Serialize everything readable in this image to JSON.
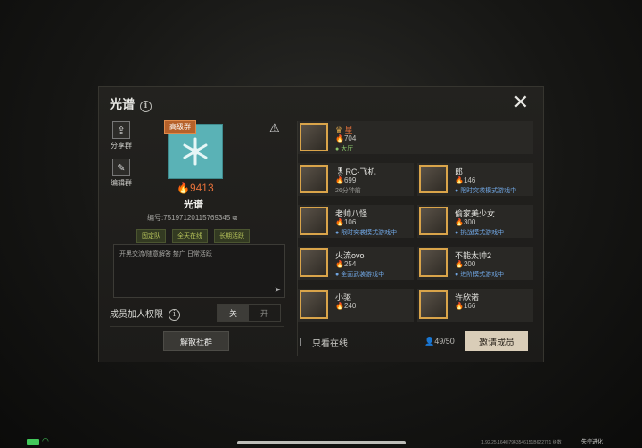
{
  "header": {
    "title": "光谱",
    "info_icon": "info-icon",
    "close_icon": "close-icon"
  },
  "left": {
    "share_label": "分享群",
    "edit_label": "编辑群",
    "tag": "高级群",
    "heat": "9413",
    "group_name": "光谱",
    "group_id": "编号:75197120115769345",
    "traits": [
      "固定队",
      "全天在线",
      "长期活跃"
    ],
    "notice": "开黑交流/随意解答 禁广 日常活跃",
    "permission_label": "成员加人权限",
    "toggle_off": "关",
    "toggle_on": "开",
    "disband_label": "解散社群"
  },
  "members": [
    {
      "name": "星",
      "score": "704",
      "status": "大厅",
      "kind": "lobby"
    },
    {
      "name": "RC-飞机",
      "score": "699",
      "status": "26分钟前",
      "kind": "idle"
    },
    {
      "name": "郎",
      "score": "146",
      "status": "限时突袭模式游戏中",
      "kind": "game"
    },
    {
      "name": "老帅八怪",
      "score": "106",
      "status": "限时突袭模式游戏中",
      "kind": "game"
    },
    {
      "name": "偷家美少女",
      "score": "300",
      "status": "挑战模式游戏中",
      "kind": "game"
    },
    {
      "name": "火流ovo",
      "score": "254",
      "status": "全面武装游戏中",
      "kind": "game"
    },
    {
      "name": "不能太帅2",
      "score": "200",
      "status": "进阶模式游戏中",
      "kind": "game"
    },
    {
      "name": "小驱",
      "score": "240",
      "status": "",
      "kind": "idle"
    },
    {
      "name": "许欣诺",
      "score": "166",
      "status": "",
      "kind": "idle"
    }
  ],
  "footer": {
    "online_only": "只看在线",
    "count": "49/50",
    "invite": "邀请成员"
  },
  "system": {
    "version": "1.92.25.1640|7943546151B622721",
    "level": "级数",
    "brand": "失控进化"
  },
  "colors": {
    "accent": "#e3703a",
    "lobby": "#88c36a",
    "game": "#6fa4e0",
    "avatar_bg": "#5ab2b6"
  }
}
